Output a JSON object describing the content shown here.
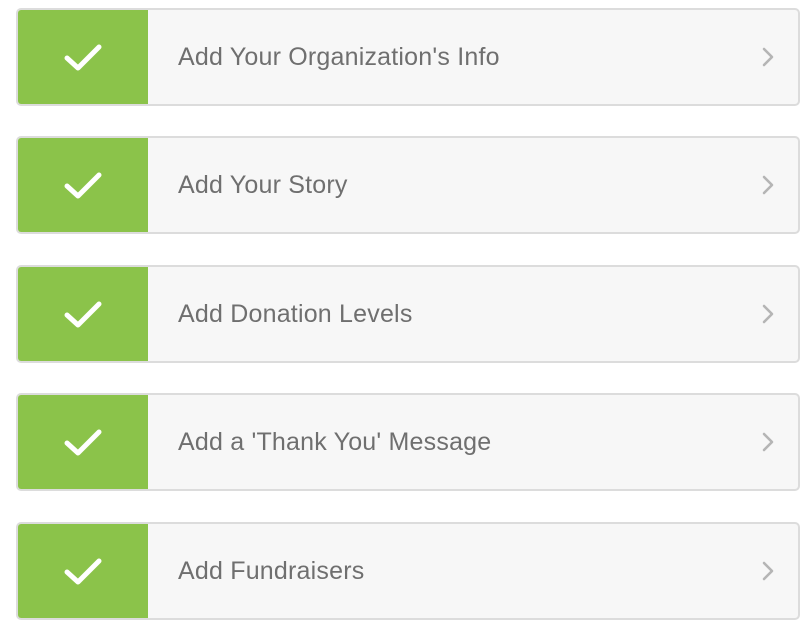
{
  "colors": {
    "check_green": "#8bc34a",
    "label_gray": "#6f6f6f",
    "row_background": "#f7f7f7",
    "border_gray": "#dcdcdc",
    "chevron_gray": "#b5b5b5"
  },
  "steps": [
    {
      "label": "Add Your Organization's Info",
      "status": "complete",
      "icon": "checkmark-icon",
      "action_icon": "chevron-right-icon"
    },
    {
      "label": "Add Your Story",
      "status": "complete",
      "icon": "checkmark-icon",
      "action_icon": "chevron-right-icon"
    },
    {
      "label": "Add Donation Levels",
      "status": "complete",
      "icon": "checkmark-icon",
      "action_icon": "chevron-right-icon"
    },
    {
      "label": "Add a 'Thank You' Message",
      "status": "complete",
      "icon": "checkmark-icon",
      "action_icon": "chevron-right-icon"
    },
    {
      "label": "Add Fundraisers",
      "status": "complete",
      "icon": "checkmark-icon",
      "action_icon": "chevron-right-icon"
    }
  ]
}
